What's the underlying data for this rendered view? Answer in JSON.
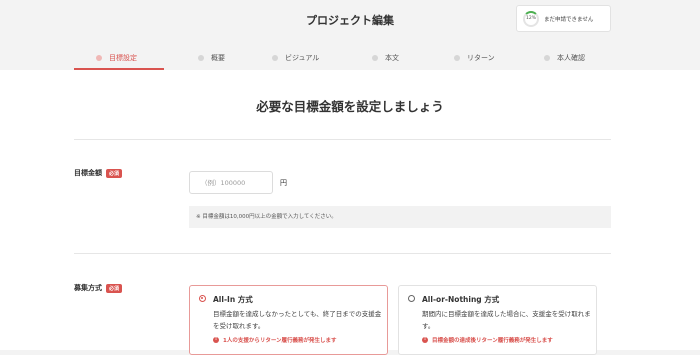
{
  "header": {
    "title": "プロジェクト編集",
    "progress_label": "12%",
    "status_text": "まだ申請できません"
  },
  "tabs": [
    {
      "label": "目標設定",
      "active": true
    },
    {
      "label": "概要",
      "active": false
    },
    {
      "label": "ビジュアル",
      "active": false
    },
    {
      "label": "本文",
      "active": false
    },
    {
      "label": "リターン",
      "active": false
    },
    {
      "label": "本人確認",
      "active": false
    }
  ],
  "main": {
    "heading": "必要な目標金額を設定しましょう",
    "goal": {
      "label": "目標金額",
      "required_badge": "必須",
      "placeholder": "（例）100000",
      "value": "",
      "unit": "円",
      "note": "※ 目標金額は10,000円以上の金額で入力してください。"
    },
    "method": {
      "label": "募集方式",
      "required_badge": "必須",
      "options": [
        {
          "title": "All-In 方式",
          "description": "目標金額を達成しなかったとしても、終了日までの支援金を受け取れます。",
          "warning": "1人の支援からリターン履行義務が発生します",
          "selected": true
        },
        {
          "title": "All-or-Nothing 方式",
          "description": "期間内に目標金額を達成した場合に、支援金を受け取れます。",
          "warning": "目標金額の達成後リターン履行義務が発生します",
          "selected": false
        }
      ]
    }
  },
  "colors": {
    "accent": "#d9534f",
    "progress": "#4caf50",
    "background": "#f3f3f3"
  }
}
